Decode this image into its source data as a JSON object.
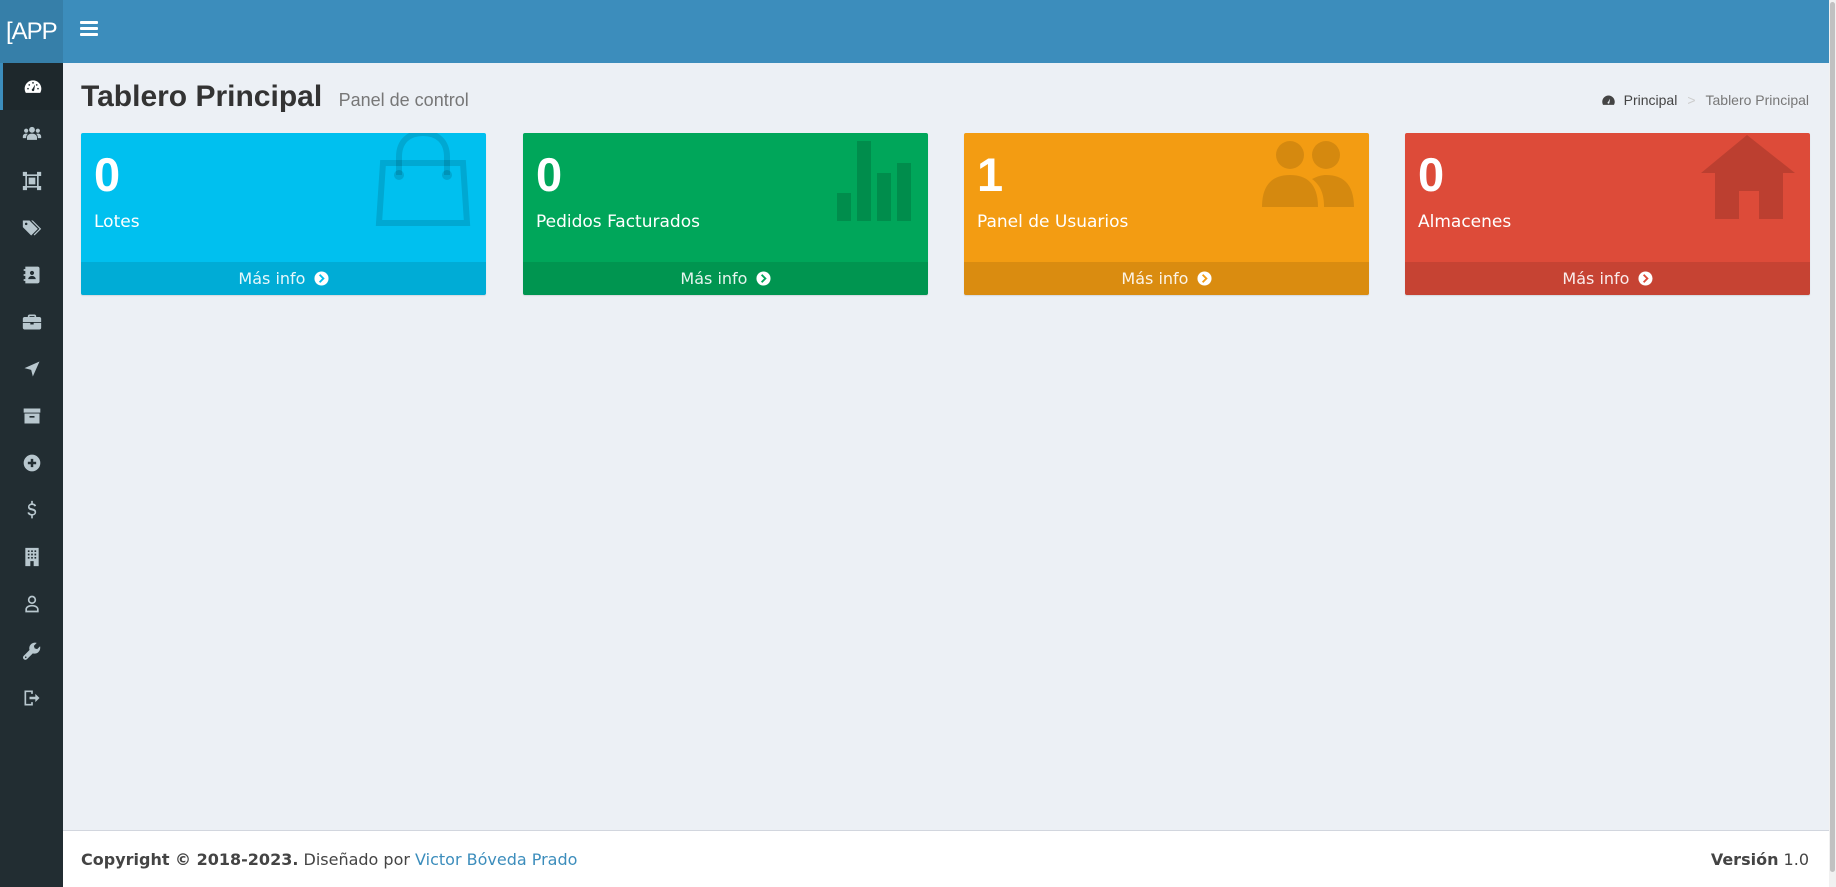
{
  "header": {
    "logo_text": "[APP"
  },
  "sidebar": {
    "items": [
      {
        "icon": "dashboard-icon",
        "active": true
      },
      {
        "icon": "users-icon"
      },
      {
        "icon": "object-group-icon"
      },
      {
        "icon": "tags-icon"
      },
      {
        "icon": "address-book-icon"
      },
      {
        "icon": "briefcase-icon"
      },
      {
        "icon": "location-arrow-icon"
      },
      {
        "icon": "archive-icon"
      },
      {
        "icon": "plus-circle-icon"
      },
      {
        "icon": "dollar-icon"
      },
      {
        "icon": "building-icon"
      },
      {
        "icon": "user-icon"
      },
      {
        "icon": "wrench-icon"
      },
      {
        "icon": "sign-out-icon"
      }
    ]
  },
  "content_header": {
    "title": "Tablero Principal",
    "subtitle": "Panel de control"
  },
  "breadcrumb": {
    "home": "Principal",
    "separator": ">",
    "current": "Tablero Principal"
  },
  "boxes": [
    {
      "count": "0",
      "label": "Lotes",
      "more": "Más info",
      "color": "#00c0ef",
      "icon": "shopping-bag-icon"
    },
    {
      "count": "0",
      "label": "Pedidos Facturados",
      "more": "Más info",
      "color": "#00a65a",
      "icon": "bar-chart-icon"
    },
    {
      "count": "1",
      "label": "Panel de Usuarios",
      "more": "Más info",
      "color": "#f39c12",
      "icon": "users-icon"
    },
    {
      "count": "0",
      "label": "Almacenes",
      "more": "Más info",
      "color": "#dd4b39",
      "icon": "home-icon"
    }
  ],
  "footer": {
    "copyright": "Copyright © 2018-2023.",
    "designed_by": "Diseñado por",
    "author": "Victor Bóveda Prado",
    "version_label": "Versión",
    "version": "1.0"
  },
  "colors": {
    "header": "#3c8dbc",
    "logo_bg": "#367fa9",
    "sidebar": "#222d32",
    "content_bg": "#ecf0f5"
  }
}
